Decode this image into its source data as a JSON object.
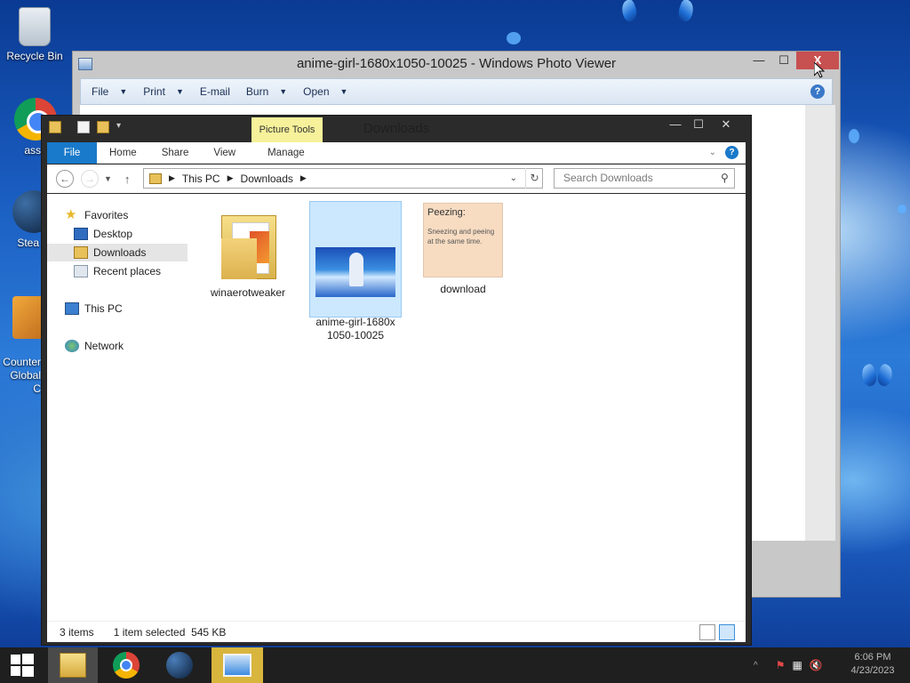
{
  "desktop": {
    "icons": [
      {
        "label": "Recycle Bin",
        "icon": "recycle-bin-icon"
      },
      {
        "label": "ass",
        "icon": "chrome-icon"
      },
      {
        "label": "Stea",
        "icon": "steam-icon"
      },
      {
        "label": "Counter\nGlobal C",
        "icon": "counter-strike-icon"
      }
    ]
  },
  "photo_viewer": {
    "title": "anime-girl-1680x1050-10025 - Windows Photo Viewer",
    "buttons": {
      "minimize": "—",
      "maximize": "☐",
      "close": "X"
    },
    "menu": [
      {
        "label": "File",
        "has_caret": true
      },
      {
        "label": "Print",
        "has_caret": true
      },
      {
        "label": "E-mail",
        "has_caret": false
      },
      {
        "label": "Burn",
        "has_caret": true
      },
      {
        "label": "Open",
        "has_caret": true
      }
    ],
    "help": "?"
  },
  "explorer": {
    "title": "Downloads",
    "context_tab_group": "Picture Tools",
    "buttons": {
      "minimize": "—",
      "maximize": "☐",
      "close": "✕"
    },
    "ribbon_tabs": [
      "File",
      "Home",
      "Share",
      "View",
      "Manage"
    ],
    "ribbon_help": "?",
    "address": {
      "segments": [
        "This PC",
        "Downloads"
      ]
    },
    "search": {
      "placeholder": "Search Downloads"
    },
    "nav_pane": {
      "favorites": "Favorites",
      "favorites_items": [
        "Desktop",
        "Downloads",
        "Recent places"
      ],
      "this_pc": "This PC",
      "network": "Network",
      "selected": "Downloads"
    },
    "files": [
      {
        "name": "winaerotweaker",
        "type": "folder",
        "selected": false
      },
      {
        "name": "anime-girl-1680x\n1050-10025",
        "type": "image",
        "selected": true
      },
      {
        "name": "download",
        "type": "image",
        "selected": false,
        "thumb_title": "Peezing:",
        "thumb_text": "Sneezing and peeing at the same time."
      }
    ],
    "status": {
      "items": "3 items",
      "selection": "1 item selected  545 KB"
    }
  },
  "taskbar": {
    "apps": [
      "start-icon",
      "file-explorer-icon",
      "chrome-icon",
      "steam-icon",
      "photo-viewer-icon"
    ],
    "clock": {
      "time": "6:06 PM",
      "date": "4/23/2023"
    }
  }
}
